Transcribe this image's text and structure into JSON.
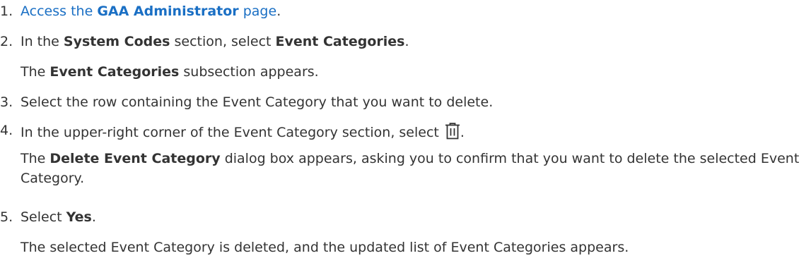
{
  "steps": [
    {
      "num": "1.",
      "link_pre": "Access the ",
      "link_bold": "GAA Administrator",
      "link_post": " page"
    },
    {
      "num": "2.",
      "pre": "In the ",
      "bold1": "System Codes",
      "mid": " section, select ",
      "bold2": "Event Categories",
      "result_bold": "Event Categories",
      "result_rest": " subsection appears.",
      "result_pre": "The "
    },
    {
      "num": "3.",
      "text": "Select the row containing the Event Category that you want to delete."
    },
    {
      "num": "4.",
      "text": "In the upper-right corner of the Event Category section, select ",
      "icon": "trash-icon",
      "result_pre": "The ",
      "result_bold": "Delete Event Category",
      "result_rest": " dialog box appears, asking you to confirm that you want to delete the selected Event Category."
    },
    {
      "num": "5.",
      "pre": "Select ",
      "bold": "Yes",
      "result": "The selected Event Category is deleted, and the updated list of Event Categories appears."
    }
  ],
  "colors": {
    "text": "#333333",
    "link": "#1a6fc4"
  }
}
